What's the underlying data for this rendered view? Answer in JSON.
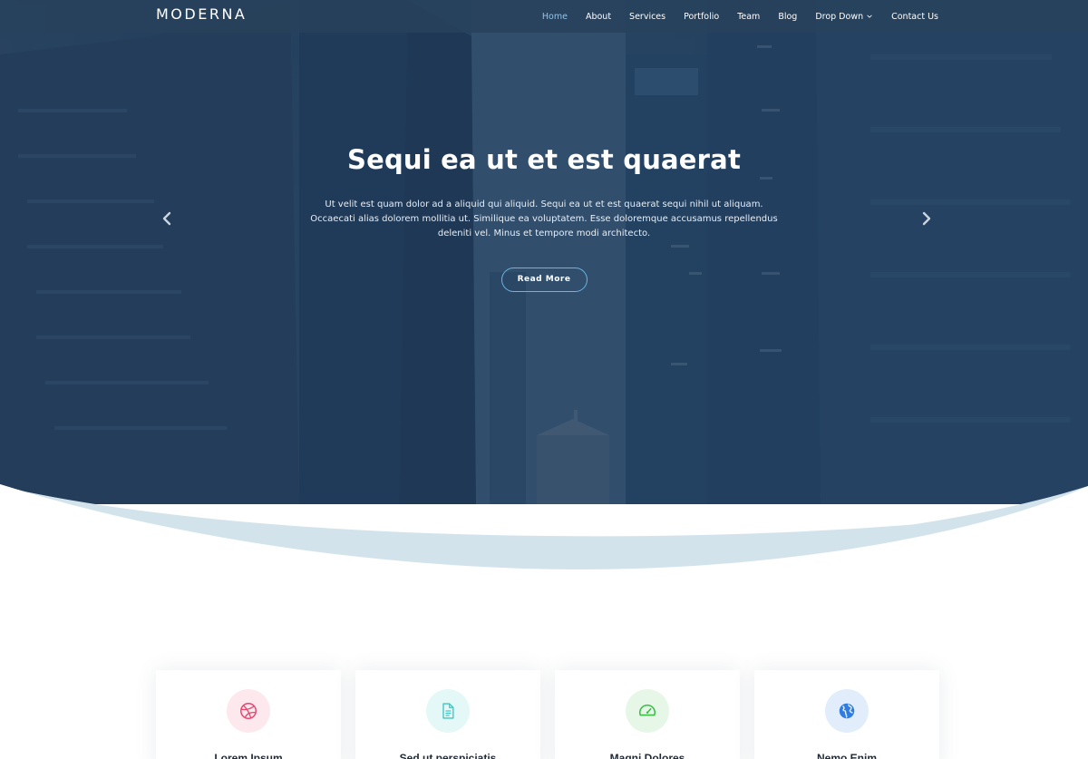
{
  "brand": "MODERNA",
  "nav": {
    "items": [
      "Home",
      "About",
      "Services",
      "Portfolio",
      "Team",
      "Blog",
      "Drop Down",
      "Contact Us"
    ],
    "active": "Home"
  },
  "hero": {
    "title": "Sequi ea ut et est quaerat",
    "text": "Ut velit est quam dolor ad a aliquid qui aliquid. Sequi ea ut et est quaerat sequi nihil ut aliquam. Occaecati alias dolorem mollitia ut. Similique ea voluptatem. Esse doloremque accusamus repellendus deleniti vel. Minus et tempore modi architecto.",
    "button": "Read More"
  },
  "services": [
    {
      "title": "Lorem Ipsum",
      "icon": "dribbble-icon",
      "color": "#e9446e",
      "bg": "#fde8ee"
    },
    {
      "title": "Sed ut perspiciatis",
      "icon": "file-text-icon",
      "color": "#3ec6c0",
      "bg": "#e3f8f7"
    },
    {
      "title": "Magni Dolores",
      "icon": "speedometer-icon",
      "color": "#3bbd46",
      "bg": "#e6f7e7"
    },
    {
      "title": "Nemo Enim",
      "icon": "globe-icon",
      "color": "#2f7de1",
      "bg": "#e2edfb"
    }
  ],
  "colors": {
    "header_bg": "#28425c",
    "accent": "#8fc3ea",
    "wave": "#d3e3ec"
  }
}
